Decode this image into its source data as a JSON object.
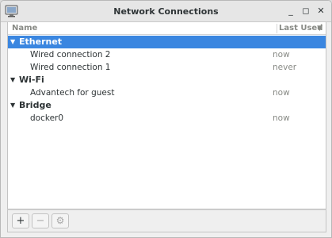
{
  "window": {
    "title": "Network Connections",
    "minimize_icon": "minimize-icon",
    "maximize_icon": "maximize-icon",
    "close_icon": "close-icon",
    "min_glyph": "_",
    "max_glyph": "◻",
    "close_glyph": "✕"
  },
  "table": {
    "col_name": "Name",
    "col_last_used": "Last Used",
    "sort_glyph": "▼"
  },
  "groups": [
    {
      "label": "Ethernet",
      "connections": [
        {
          "name": "Wired connection 2",
          "last_used": "now"
        },
        {
          "name": "Wired connection 1",
          "last_used": "never"
        }
      ]
    },
    {
      "label": "Wi-Fi",
      "connections": [
        {
          "name": "Advantech for guest",
          "last_used": "now"
        }
      ]
    },
    {
      "label": "Bridge",
      "connections": [
        {
          "name": "docker0",
          "last_used": "now"
        }
      ]
    }
  ],
  "toolbar": {
    "add_glyph": "+",
    "remove_glyph": "−",
    "settings_glyph": "⚙"
  },
  "colors": {
    "selection": "#3a86e0",
    "muted": "#888a85",
    "text": "#2e3436"
  }
}
